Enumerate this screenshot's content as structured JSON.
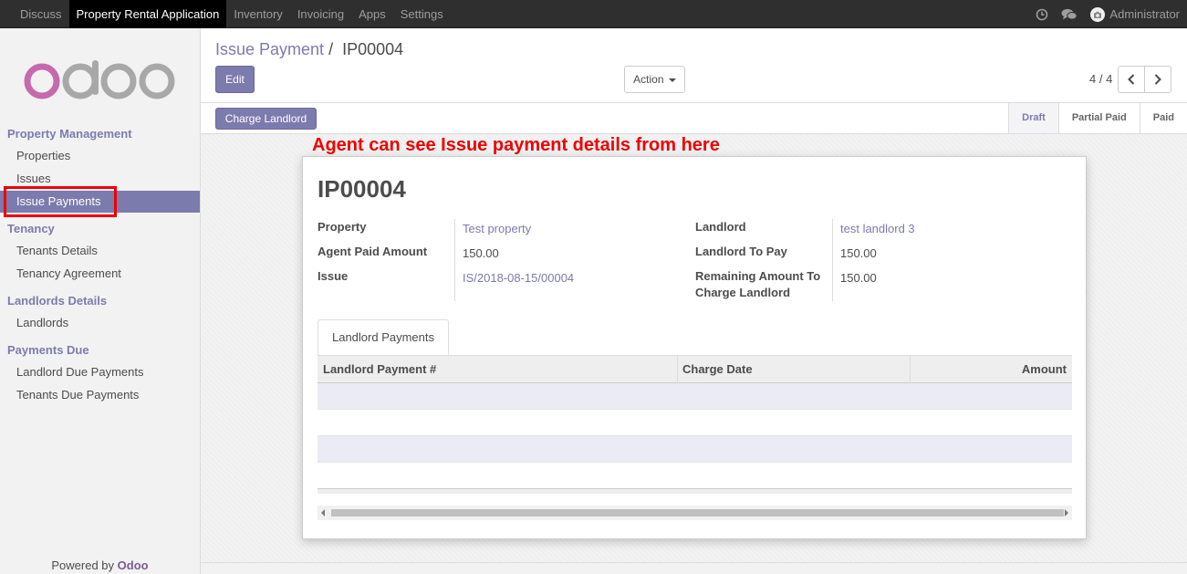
{
  "topbar": {
    "menu": [
      "Discuss",
      "Property Rental Application",
      "Inventory",
      "Invoicing",
      "Apps",
      "Settings"
    ],
    "active_index": 1,
    "user_name": "Administrator",
    "icons": [
      "clock-icon",
      "chat-icon"
    ]
  },
  "sidebar": {
    "sections": [
      {
        "title": "Property Management",
        "items": [
          "Properties",
          "Issues",
          "Issue Payments"
        ]
      },
      {
        "title": "Tenancy",
        "items": [
          "Tenants Details",
          "Tenancy Agreement"
        ]
      },
      {
        "title": "Landlords Details",
        "items": [
          "Landlords"
        ]
      },
      {
        "title": "Payments Due",
        "items": [
          "Landlord Due Payments",
          "Tenants Due Payments"
        ]
      }
    ],
    "active_item": "Issue Payments",
    "powered_prefix": "Powered by",
    "powered_brand": "Odoo"
  },
  "control_panel": {
    "breadcrumb_parent": "Issue Payment",
    "breadcrumb_sep": "/",
    "breadcrumb_current": "IP00004",
    "edit_label": "Edit",
    "action_label": "Action",
    "pager": "4 / 4"
  },
  "statusbar": {
    "charge_label": "Charge Landlord",
    "stages": [
      "Draft",
      "Partial Paid",
      "Paid"
    ],
    "current_stage": "Draft"
  },
  "annotation": "Agent can see Issue payment details from here",
  "record": {
    "title": "IP00004",
    "left_fields": [
      {
        "label": "Property",
        "value": "Test property",
        "link": true
      },
      {
        "label": "Agent Paid Amount",
        "value": "150.00",
        "link": false
      },
      {
        "label": "Issue",
        "value": "IS/2018-08-15/00004",
        "link": true
      }
    ],
    "right_fields": [
      {
        "label": "Landlord",
        "value": "test landlord 3",
        "link": true
      },
      {
        "label": "Landlord To Pay",
        "value": "150.00",
        "link": false
      },
      {
        "label": "Remaining Amount To Charge Landlord",
        "value": "150.00",
        "link": false
      }
    ],
    "tab_label": "Landlord Payments",
    "table_columns": [
      "Landlord Payment #",
      "Charge Date",
      "Amount"
    ]
  },
  "colors": {
    "brand": "#7c7bad",
    "annotation": "#ef0000",
    "topbar": "#2f2f2f"
  }
}
